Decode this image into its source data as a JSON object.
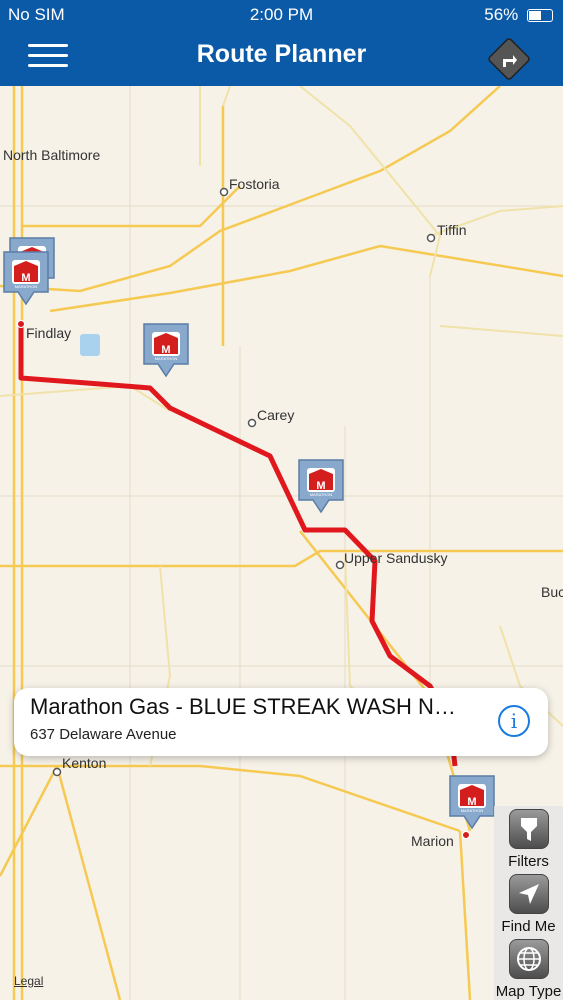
{
  "status_bar": {
    "carrier": "No SIM",
    "time": "2:00 PM",
    "battery": "56%"
  },
  "header": {
    "title": "Route Planner",
    "menu_icon": "hamburger-menu-icon",
    "directions_icon": "directions-icon"
  },
  "map": {
    "places": {
      "north_baltimore": "North Baltimore",
      "fostoria": "Fostoria",
      "tiffin": "Tiffin",
      "findlay": "Findlay",
      "carey": "Carey",
      "upper_sandusky": "Upper Sandusky",
      "bucyrus_partial": "Buc",
      "kenton": "Kenton",
      "marion": "Marion"
    },
    "route_color": "#e0181e",
    "marker_brand": "MARATHON",
    "marker_logo": "M",
    "legal": "Legal"
  },
  "callout": {
    "title": "Marathon Gas - BLUE STREAK WASH N…",
    "address": "637 Delaware Avenue",
    "info_symbol": "i"
  },
  "side_panel": {
    "filters": "Filters",
    "find_me": "Find Me",
    "map_type": "Map Type"
  }
}
